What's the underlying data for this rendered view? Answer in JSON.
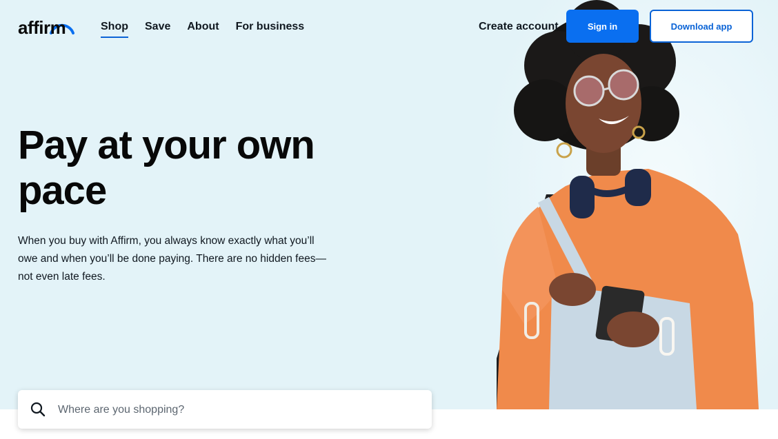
{
  "brand": {
    "logo_text": "affirm",
    "logo_color": "#0a6ff0"
  },
  "nav": {
    "items": [
      {
        "label": "Shop",
        "active": true
      },
      {
        "label": "Save",
        "active": false
      },
      {
        "label": "About",
        "active": false
      },
      {
        "label": "For business",
        "active": false
      }
    ]
  },
  "header": {
    "create_account": "Create account",
    "sign_in": "Sign in",
    "download_app": "Download app"
  },
  "hero": {
    "headline": "Pay at your own pace",
    "body": "When you buy with Affirm, you always know exactly what you’ll owe and when you’ll be done paying. There are no hidden fees—not even late fees."
  },
  "search": {
    "placeholder": "Where are you shopping?",
    "value": "",
    "icon": "search-icon"
  },
  "colors": {
    "hero_bg": "#e3f3f8",
    "accent": "#0a6ff0",
    "text": "#101820"
  }
}
